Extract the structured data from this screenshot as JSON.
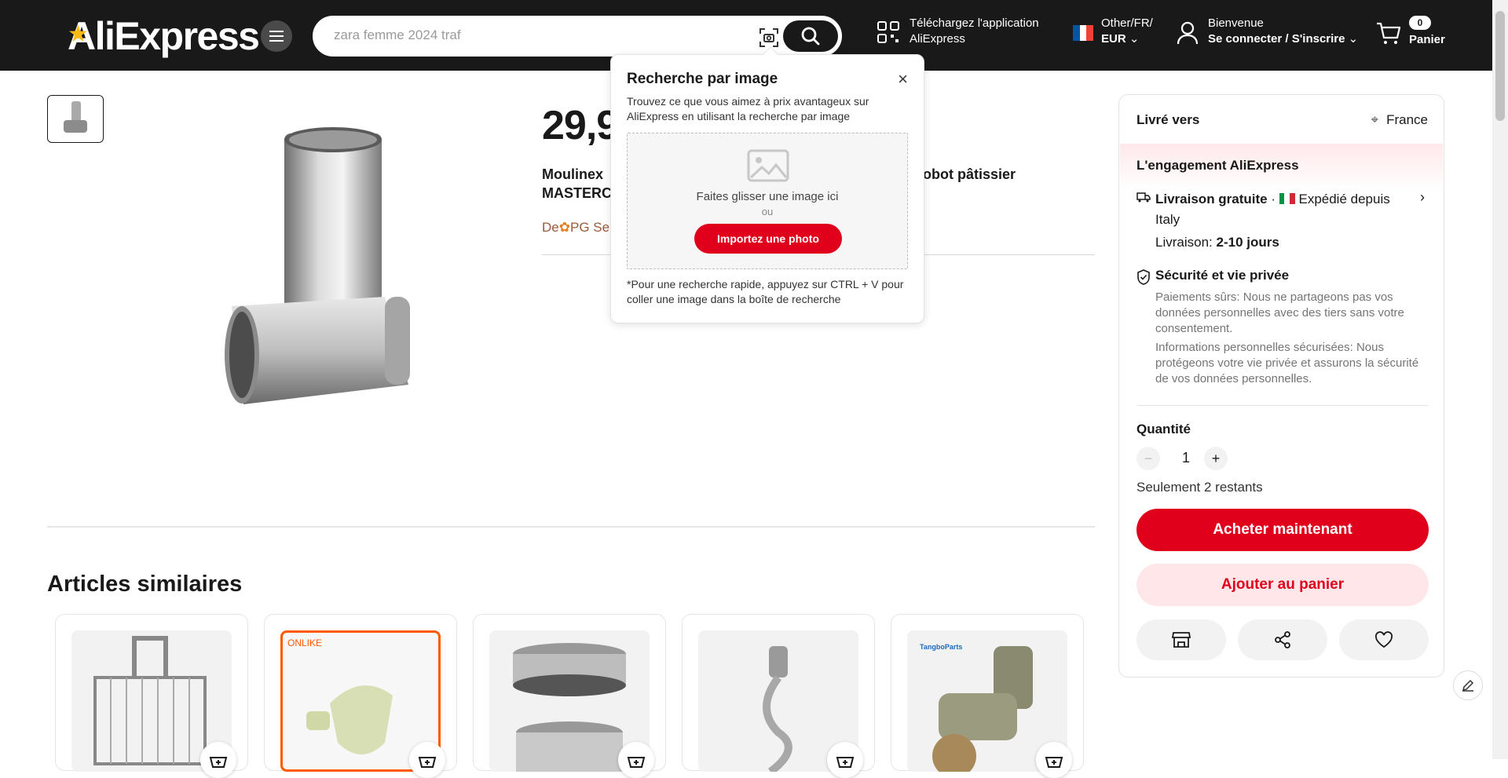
{
  "header": {
    "logo": "AliExpress",
    "search_placeholder": "zara femme 2024 traf",
    "app_line1": "Téléchargez l'application",
    "app_line2": "AliExpress",
    "locale_line1": "Other/FR/",
    "locale_line2": "EUR",
    "welcome": "Bienvenue",
    "signin": "Se connecter / S'inscrire",
    "cart_count": "0",
    "cart_label": "Panier"
  },
  "popup": {
    "title": "Recherche par image",
    "close": "×",
    "description": "Trouvez ce que vous aimez à prix avantageux sur AliExpress en utilisant la recherche par image",
    "drop_text": "Faites glisser une image ici",
    "or_text": "ou",
    "upload_button": "Importez une photo",
    "hint": "*Pour une recherche rapide, appuyez sur CTRL + V pour coller une image dans la boîte de recherche"
  },
  "product": {
    "price": "29,9",
    "title_line1": "Moulinex",
    "title_line1_end": "obot pâtissier",
    "title_line2": "MASTERC",
    "seller_prefix": "De",
    "seller_name": "PG Se"
  },
  "similar": {
    "title": "Articles similaires",
    "card2_brand": "ONLIKE",
    "card5_brand": "TangboParts"
  },
  "panel": {
    "ship_to_label": "Livré vers",
    "ship_to_value": "France",
    "engagement_title": "L'engagement AliExpress",
    "free_shipping": "Livraison gratuite",
    "shipped_from": "Expédié depuis",
    "shipped_country": "Italy",
    "delivery_label": "Livraison:",
    "delivery_value": "2-10 jours",
    "security_title": "Sécurité et vie privée",
    "security_text1": "Paiements sûrs: Nous ne partageons pas vos données personnelles avec des tiers sans votre consentement.",
    "security_text2": "Informations personnelles sécurisées: Nous protégeons votre vie privée et assurons la sécurité de vos données personnelles.",
    "quantity_label": "Quantité",
    "quantity_value": "1",
    "stock_text": "Seulement 2 restants",
    "buy_now": "Acheter maintenant",
    "add_to_cart": "Ajouter au panier"
  },
  "colors": {
    "brand_red": "#e0001b",
    "header_bg": "#191919",
    "logo_star": "#fdb913"
  }
}
